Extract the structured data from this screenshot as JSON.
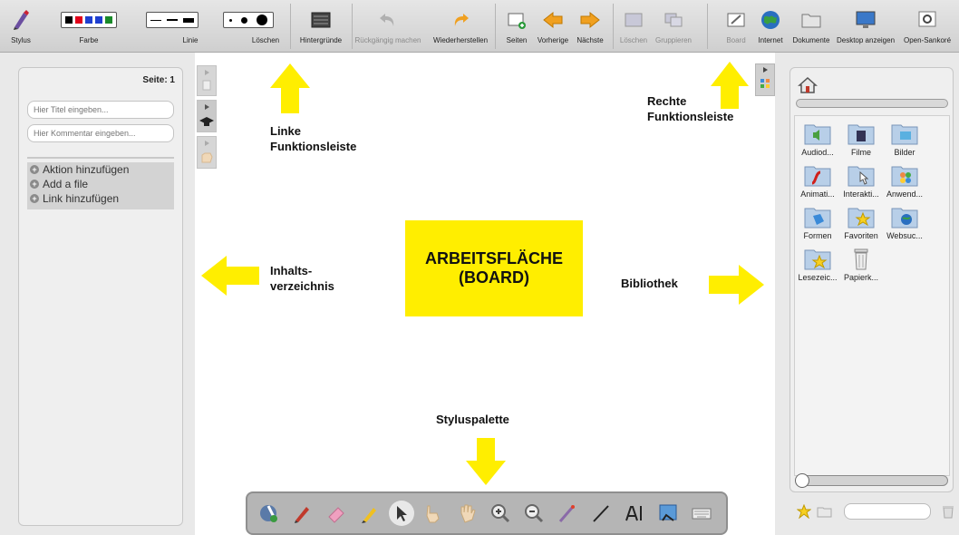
{
  "toolbar": {
    "stylus_label": "Stylus",
    "color_label": "Farbe",
    "line_label": "Linie",
    "erase_label": "Löschen",
    "backgrounds_label": "Hintergründe",
    "undo_label": "Rückgängig machen",
    "redo_label": "Wiederherstellen",
    "pages_label": "Seiten",
    "prev_label": "Vorherige",
    "next_label": "Nächste",
    "delete_label": "Löschen",
    "group_label": "Gruppieren",
    "board_label": "Board",
    "internet_label": "Internet",
    "documents_label": "Dokumente",
    "desktop_label": "Desktop anzeigen",
    "opensankore_label": "Open-Sankoré",
    "colors": [
      "#000000",
      "#e2001a",
      "#1f3fd0",
      "#1a8a2a"
    ]
  },
  "left_panel": {
    "page_label": "Seite: 1",
    "title_placeholder": "Hier Titel eingeben...",
    "comment_placeholder": "Hier Kommentar eingeben...",
    "actions": [
      "Aktion hinzufügen",
      "Add a file",
      "Link hinzufügen"
    ]
  },
  "library": {
    "items": [
      {
        "label": "Audiod...",
        "icon": "audio-folder-icon"
      },
      {
        "label": "Filme",
        "icon": "film-folder-icon"
      },
      {
        "label": "Bilder",
        "icon": "image-folder-icon"
      },
      {
        "label": "Animati...",
        "icon": "flash-folder-icon"
      },
      {
        "label": "Interakti...",
        "icon": "interactive-folder-icon"
      },
      {
        "label": "Anwend...",
        "icon": "apps-folder-icon"
      },
      {
        "label": "Formen",
        "icon": "shapes-folder-icon"
      },
      {
        "label": "Favoriten",
        "icon": "favorites-folder-icon"
      },
      {
        "label": "Websuc...",
        "icon": "websearch-folder-icon"
      },
      {
        "label": "Lesezeic...",
        "icon": "bookmarks-folder-icon"
      },
      {
        "label": "Papierk...",
        "icon": "trash-icon"
      }
    ]
  },
  "annotations": {
    "left_strip": [
      "Linke",
      "Funktionsleiste"
    ],
    "right_strip": [
      "Rechte",
      "Funktionsleiste"
    ],
    "toc": [
      "Inhalts-",
      "verzeichnis"
    ],
    "library": "Bibliothek",
    "board": [
      "ARBEITSFLÄCHE",
      "(BOARD)"
    ],
    "stylus_palette": "Styluspalette"
  },
  "accent_yellow": "#ffee00"
}
